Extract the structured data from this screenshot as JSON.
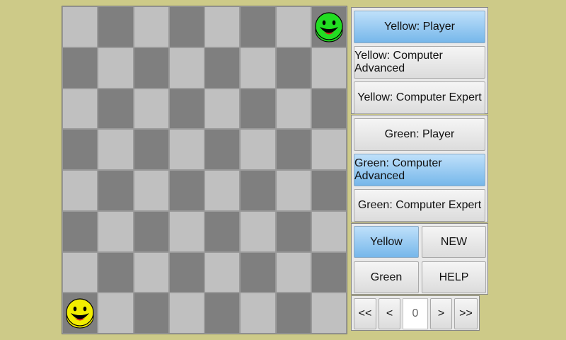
{
  "board": {
    "rows": 8,
    "cols": 8,
    "pieces": [
      {
        "row": 0,
        "col": 7,
        "color": "green"
      },
      {
        "row": 7,
        "col": 0,
        "color": "yellow"
      }
    ]
  },
  "yellow_panel": {
    "player": "Yellow: Player",
    "advanced": "Yellow: Computer Advanced",
    "expert": "Yellow: Computer Expert"
  },
  "green_panel": {
    "player": "Green: Player",
    "advanced": "Green: Computer Advanced",
    "expert": "Green: Computer Expert"
  },
  "controls": {
    "yellow": "Yellow",
    "new": "NEW",
    "green": "Green",
    "help": "HELP"
  },
  "nav": {
    "first": "<<",
    "prev": "<",
    "move": "0",
    "next": ">",
    "last": ">>"
  },
  "colors": {
    "background": "#cdca88",
    "light_square": "#c0c0c0",
    "dark_square": "#7f7f7f",
    "selected_button": "#76b7ea",
    "yellow_piece": "#f2ee00",
    "green_piece": "#22dd22"
  },
  "icons": {
    "piece": "smiley-face-icon"
  }
}
